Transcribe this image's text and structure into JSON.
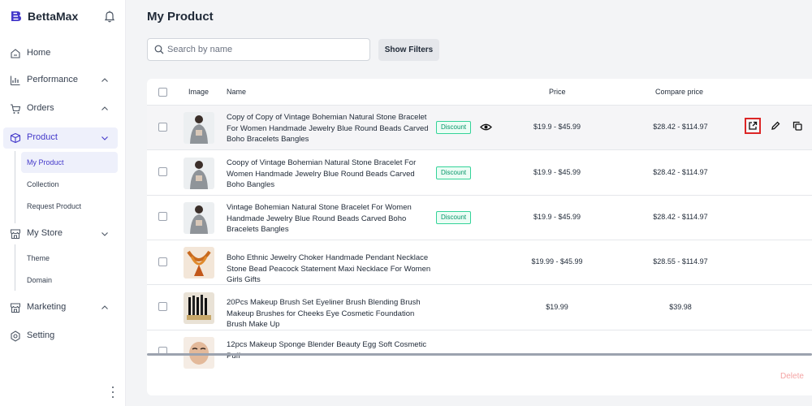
{
  "app": {
    "name": "BettaMax",
    "brand_color": "#4338ca",
    "logo_icon": "bettamax-logo-icon",
    "bell_icon": "bell-icon"
  },
  "sidebar": {
    "items": [
      {
        "label": "Home",
        "icon": "home-icon"
      },
      {
        "label": "Performance",
        "icon": "bar-chart-icon",
        "chevron": "up"
      },
      {
        "label": "Orders",
        "icon": "cart-icon",
        "chevron": "up"
      },
      {
        "label": "Product",
        "icon": "box-icon",
        "chevron": "down",
        "active": true
      },
      {
        "label": "My Store",
        "icon": "store-icon",
        "chevron": "down"
      },
      {
        "label": "Marketing",
        "icon": "store-icon",
        "chevron": "up"
      },
      {
        "label": "Setting",
        "icon": "gear-icon"
      }
    ],
    "product_sub": [
      {
        "label": "My Product",
        "active": true
      },
      {
        "label": "Collection"
      },
      {
        "label": "Request Product"
      }
    ],
    "store_sub": [
      {
        "label": "Theme"
      },
      {
        "label": "Domain"
      }
    ],
    "more_icon": "kebab-menu-icon"
  },
  "page": {
    "title": "My Product",
    "search_placeholder": "Search by name",
    "search_value": "",
    "filters_label": "Show Filters",
    "delete_label": "Delete"
  },
  "table": {
    "headers": {
      "image": "Image",
      "name": "Name",
      "price": "Price",
      "compare_price": "Compare price"
    },
    "rows": [
      {
        "name": "Copy of Copy of Vintage Bohemian Natural Stone Bracelet For Women Handmade Jewelry Blue Round Beads Carved Boho Bracelets Bangles",
        "badge": "Discount",
        "price": "$19.9 - $45.99",
        "compare_price": "$28.42 - $114.97",
        "thumb": "person"
      },
      {
        "name": "Coopy of Vintage Bohemian Natural Stone Bracelet For Women Handmade Jewelry Blue Round Beads Carved Boho Bangles",
        "badge": "Discount",
        "price": "$19.9 - $45.99",
        "compare_price": "$28.42 - $114.97",
        "thumb": "person"
      },
      {
        "name": "Vintage Bohemian Natural Stone Bracelet For Women Handmade Jewelry Blue Round Beads Carved Boho Bracelets Bangles",
        "badge": "Discount",
        "price": "$19.9 - $45.99",
        "compare_price": "$28.42 - $114.97",
        "thumb": "person"
      },
      {
        "name": "Boho Ethnic Jewelry Choker Handmade Pendant Necklace Stone Bead Peacock Statement Maxi Necklace For Women Girls Gifts",
        "badge": "",
        "price": "$19.99 - $45.99",
        "compare_price": "$28.55 - $114.97",
        "thumb": "necklace"
      },
      {
        "name": "20Pcs Makeup Brush Set Eyeliner Brush Blending Brush Makeup Brushes for Cheeks Eye Cosmetic Foundation Brush Make Up",
        "badge": "",
        "price": "$19.99",
        "compare_price": "$39.98",
        "thumb": "brushes"
      },
      {
        "name": "12pcs Makeup Sponge Blender Beauty Egg Soft Cosmetic Puff",
        "badge": "",
        "price": "",
        "compare_price": "",
        "thumb": "face"
      }
    ],
    "row_actions": [
      "external-link-icon",
      "pencil-icon",
      "copy-icon"
    ],
    "view_icon": "eye-icon"
  }
}
